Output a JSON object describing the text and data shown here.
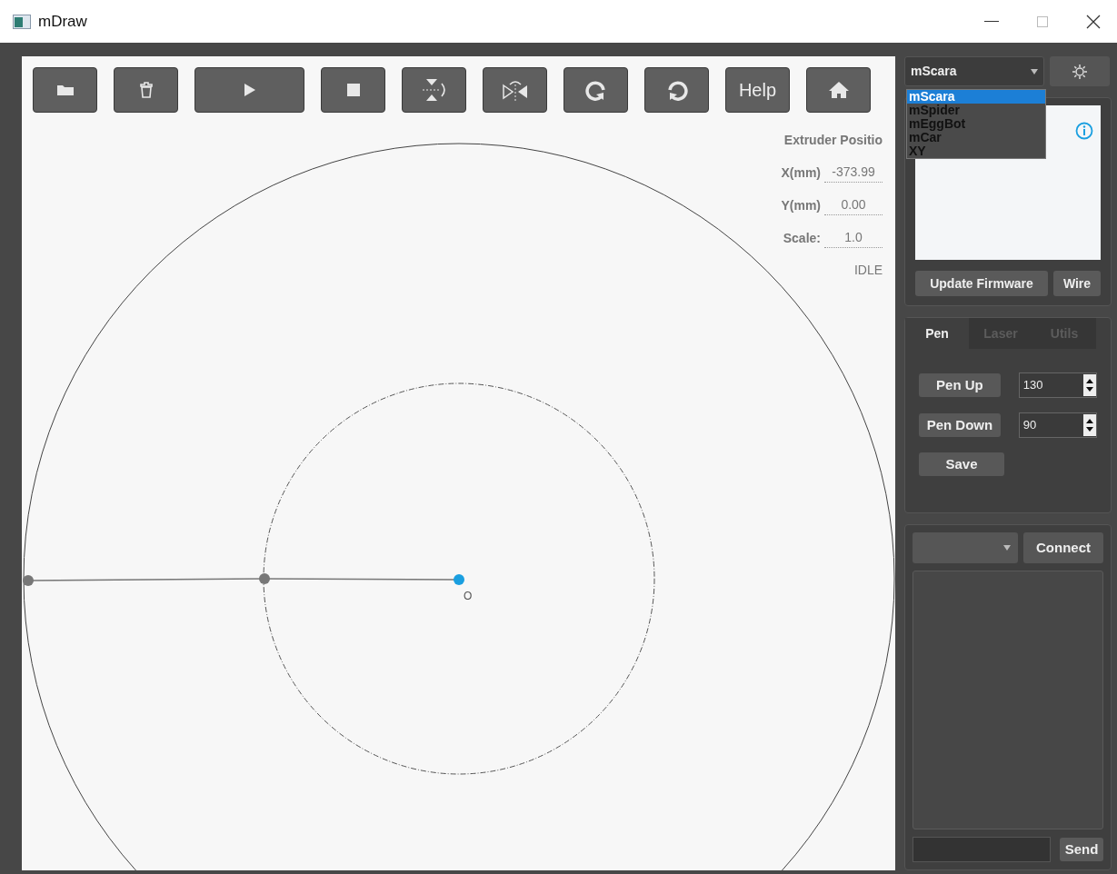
{
  "window": {
    "title": "mDraw"
  },
  "toolbar": [
    {
      "kind": "open"
    },
    {
      "kind": "delete"
    },
    {
      "kind": "play"
    },
    {
      "kind": "stop"
    },
    {
      "kind": "flip-vertical"
    },
    {
      "kind": "flip-horizontal"
    },
    {
      "kind": "rotate-cw"
    },
    {
      "kind": "rotate-ccw"
    },
    {
      "kind": "text",
      "label": "Help"
    },
    {
      "kind": "home"
    }
  ],
  "extruder": {
    "title": "Extruder Positio",
    "fields": [
      {
        "label": "X(mm)",
        "value": "-373.99"
      },
      {
        "label": "Y(mm)",
        "value": "0.00"
      },
      {
        "label": "Scale:",
        "value": "1.0"
      }
    ],
    "status": "IDLE"
  },
  "canvas": {
    "origin_label": "O"
  },
  "machine": {
    "value": "mScara",
    "options": [
      {
        "label": "mScara",
        "selected": true
      },
      {
        "label": "mSpider",
        "selected": false
      },
      {
        "label": "mEggBot",
        "selected": false
      },
      {
        "label": "mCar",
        "selected": false
      },
      {
        "label": "XY",
        "selected": false
      }
    ],
    "buttons": [
      "Update Firmware",
      "Wire"
    ]
  },
  "tabs": [
    {
      "label": "Pen",
      "selected": true
    },
    {
      "label": "Laser",
      "selected": false
    },
    {
      "label": "Utils",
      "selected": false
    }
  ],
  "pen": {
    "rows": [
      {
        "button": "Pen Up",
        "value": "130"
      },
      {
        "button": "Pen Down",
        "value": "90"
      }
    ],
    "save": "Save"
  },
  "connection": {
    "connect": "Connect",
    "send": "Send"
  }
}
